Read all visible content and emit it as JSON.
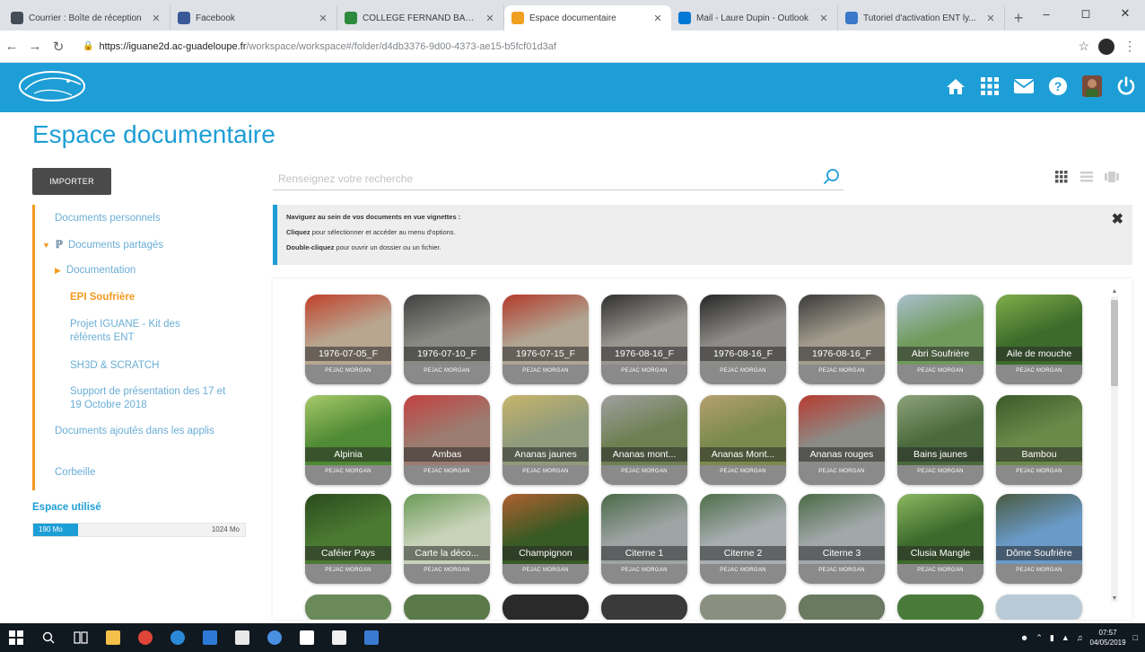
{
  "browser": {
    "tabs": [
      {
        "title": "Courrier : Boîte de réception",
        "color": "#444c56",
        "active": false
      },
      {
        "title": "Facebook",
        "color": "#3b5998",
        "active": false
      },
      {
        "title": "COLLEGE FERNAND BALIN :",
        "color": "#2d8a3d",
        "active": false
      },
      {
        "title": "Espace documentaire",
        "color": "#f0a020",
        "active": true
      },
      {
        "title": "Mail - Laure Dupin - Outlook",
        "color": "#0078d4",
        "active": false
      },
      {
        "title": "Tutoriel d'activation ENT ly...",
        "color": "#3a78c9",
        "active": false
      }
    ],
    "url_host": "https://iguane2d.ac-guadeloupe.fr",
    "url_path": "/workspace/workspace#/folder/d4db3376-9d00-4373-ae15-b5fcf01d3af"
  },
  "header": {
    "icons": [
      "home-icon",
      "apps-grid-icon",
      "mail-icon",
      "help-icon",
      "avatar",
      "power-icon"
    ]
  },
  "page": {
    "title": "Espace documentaire",
    "import_label": "IMPORTER"
  },
  "sidebar": {
    "items": [
      {
        "label": "Documents personnels"
      },
      {
        "label": "Documents partagés"
      },
      {
        "label": "Documentation"
      },
      {
        "label": "EPI Soufrière"
      },
      {
        "label": "Projet IGUANE - Kit des référents ENT"
      },
      {
        "label": "SH3D & SCRATCH"
      },
      {
        "label": "Support de présentation des 17 et 19 Octobre 2018"
      },
      {
        "label": "Documents ajoutés dans les applis"
      },
      {
        "label": "Corbeille"
      }
    ],
    "space_label": "Espace utilisé",
    "quota_used": "190 Mo",
    "quota_total": "1024 Mo",
    "quota_fraction": 0.21
  },
  "search": {
    "placeholder": "Renseignez votre recherche"
  },
  "info": {
    "line1": "Naviguez au sein de vos documents en vue vignettes :",
    "line2_bold": "Cliquez",
    "line2_rest": " pour sélectionner et accéder au menu d'options.",
    "line3_bold": "Double-cliquez",
    "line3_rest": " pour ouvrir un dossier ou un fichier."
  },
  "files": [
    {
      "name": "1976-07-05_F",
      "owner": "PEJAC MORGAN",
      "color": "#b8a690",
      "accent": "#c2402a"
    },
    {
      "name": "1976-07-10_F",
      "owner": "PEJAC MORGAN",
      "color": "#8a8a84",
      "accent": "#404040"
    },
    {
      "name": "1976-07-15_F",
      "owner": "PEJAC MORGAN",
      "color": "#b0a592",
      "accent": "#b43a2a"
    },
    {
      "name": "1976-08-16_F",
      "owner": "PEJAC MORGAN",
      "color": "#9a9690",
      "accent": "#303030"
    },
    {
      "name": "1976-08-16_F",
      "owner": "PEJAC MORGAN",
      "color": "#8e8c88",
      "accent": "#262626"
    },
    {
      "name": "1976-08-16_F",
      "owner": "PEJAC MORGAN",
      "color": "#a49d8e",
      "accent": "#3a3a3a"
    },
    {
      "name": "Abri Soufrière",
      "owner": "PEJAC MORGAN",
      "color": "#6f9a5c",
      "accent": "#aabfcc"
    },
    {
      "name": "Aile de mouche",
      "owner": "PEJAC MORGAN",
      "color": "#3d6b2b",
      "accent": "#7fae4a"
    },
    {
      "name": "Alpinia",
      "owner": "PEJAC MORGAN",
      "color": "#4f8a34",
      "accent": "#a7c96a"
    },
    {
      "name": "Ambas",
      "owner": "PEJAC MORGAN",
      "color": "#9c7c70",
      "accent": "#c44040"
    },
    {
      "name": "Ananas jaunes",
      "owner": "PEJAC MORGAN",
      "color": "#8f9b7c",
      "accent": "#c7b46a"
    },
    {
      "name": "Ananas mont...",
      "owner": "PEJAC MORGAN",
      "color": "#6e8052",
      "accent": "#a0a0a0"
    },
    {
      "name": "Ananas Mont...",
      "owner": "PEJAC MORGAN",
      "color": "#7a8a4c",
      "accent": "#b5a070"
    },
    {
      "name": "Ananas rouges",
      "owner": "PEJAC MORGAN",
      "color": "#8c8c86",
      "accent": "#b83a30"
    },
    {
      "name": "Bains jaunes",
      "owner": "PEJAC MORGAN",
      "color": "#4a6a3c",
      "accent": "#8ea27a"
    },
    {
      "name": "Bambou",
      "owner": "PEJAC MORGAN",
      "color": "#6a8a4a",
      "accent": "#3c5a2a"
    },
    {
      "name": "Caféier Pays",
      "owner": "PEJAC MORGAN",
      "color": "#4b7a32",
      "accent": "#2a4a1e"
    },
    {
      "name": "Carte la déco...",
      "owner": "PEJAC MORGAN",
      "color": "#c7d2b8",
      "accent": "#6a9a56"
    },
    {
      "name": "Champignon",
      "owner": "PEJAC MORGAN",
      "color": "#385a24",
      "accent": "#b06030"
    },
    {
      "name": "Citerne 1",
      "owner": "PEJAC MORGAN",
      "color": "#9ea4a4",
      "accent": "#4a6a48"
    },
    {
      "name": "Citerne 2",
      "owner": "PEJAC MORGAN",
      "color": "#a7adb0",
      "accent": "#4e6e4a"
    },
    {
      "name": "Citerne 3",
      "owner": "PEJAC MORGAN",
      "color": "#a2a8aa",
      "accent": "#4a6a46"
    },
    {
      "name": "Clusia Mangle",
      "owner": "PEJAC MORGAN",
      "color": "#3c6a2c",
      "accent": "#8bb860"
    },
    {
      "name": "Dôme Soufrière",
      "owner": "PEJAC MORGAN",
      "color": "#6a9ac8",
      "accent": "#4a5a40"
    }
  ],
  "partial_row_colors": [
    "#6a8a5a",
    "#5a7a4a",
    "#2a2a2a",
    "#3a3a3a",
    "#8a9080",
    "#6a7a60",
    "#4a7a3a",
    "#b8cad6",
    "#a0a8a0"
  ],
  "taskbar": {
    "time": "07:57",
    "date": "04/05/2019"
  }
}
